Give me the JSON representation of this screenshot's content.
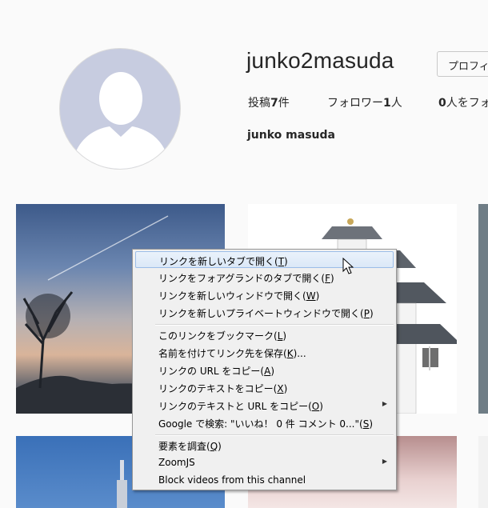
{
  "profile": {
    "username": "junko2masuda",
    "edit_button": "プロフィ",
    "posts_label": "投稿",
    "posts_count": "7",
    "posts_unit": "件",
    "followers_label": "フォロワー",
    "followers_count": "1",
    "followers_unit": "人",
    "following_count": "0",
    "following_label": "人をフォ",
    "full_name": "junko masuda"
  },
  "context_menu": {
    "items": [
      {
        "label": "リンクを新しいタブで開く(",
        "key": "T",
        "tail": ")"
      },
      {
        "label": "リンクをフォアグランドのタブで開く(",
        "key": "F",
        "tail": ")"
      },
      {
        "label": "リンクを新しいウィンドウで開く(",
        "key": "W",
        "tail": ")"
      },
      {
        "label": "リンクを新しいプライベートウィンドウで開く(",
        "key": "P",
        "tail": ")"
      },
      {
        "label": "このリンクをブックマーク(",
        "key": "L",
        "tail": ")"
      },
      {
        "label": "名前を付けてリンク先を保存(",
        "key": "K",
        "tail": ")..."
      },
      {
        "label": "リンクの URL をコピー(",
        "key": "A",
        "tail": ")"
      },
      {
        "label": "リンクのテキストをコピー(",
        "key": "X",
        "tail": ")"
      },
      {
        "label": "リンクのテキストと URL をコピー(",
        "key": "O",
        "tail": ")"
      },
      {
        "label": "Google で検索: \"いいね！ 0 件 コメント 0...\"(",
        "key": "S",
        "tail": ")"
      },
      {
        "label": "要素を調査(",
        "key": "Q",
        "tail": ")"
      },
      {
        "label": "ZoomJS",
        "key": "",
        "tail": ""
      },
      {
        "label": "Block videos from this channel",
        "key": "",
        "tail": ""
      }
    ]
  },
  "colors": {
    "menu_bg": "#f0f0f0",
    "highlight_border": "#9bbde8",
    "avatar_bg": "#c7cce0"
  }
}
